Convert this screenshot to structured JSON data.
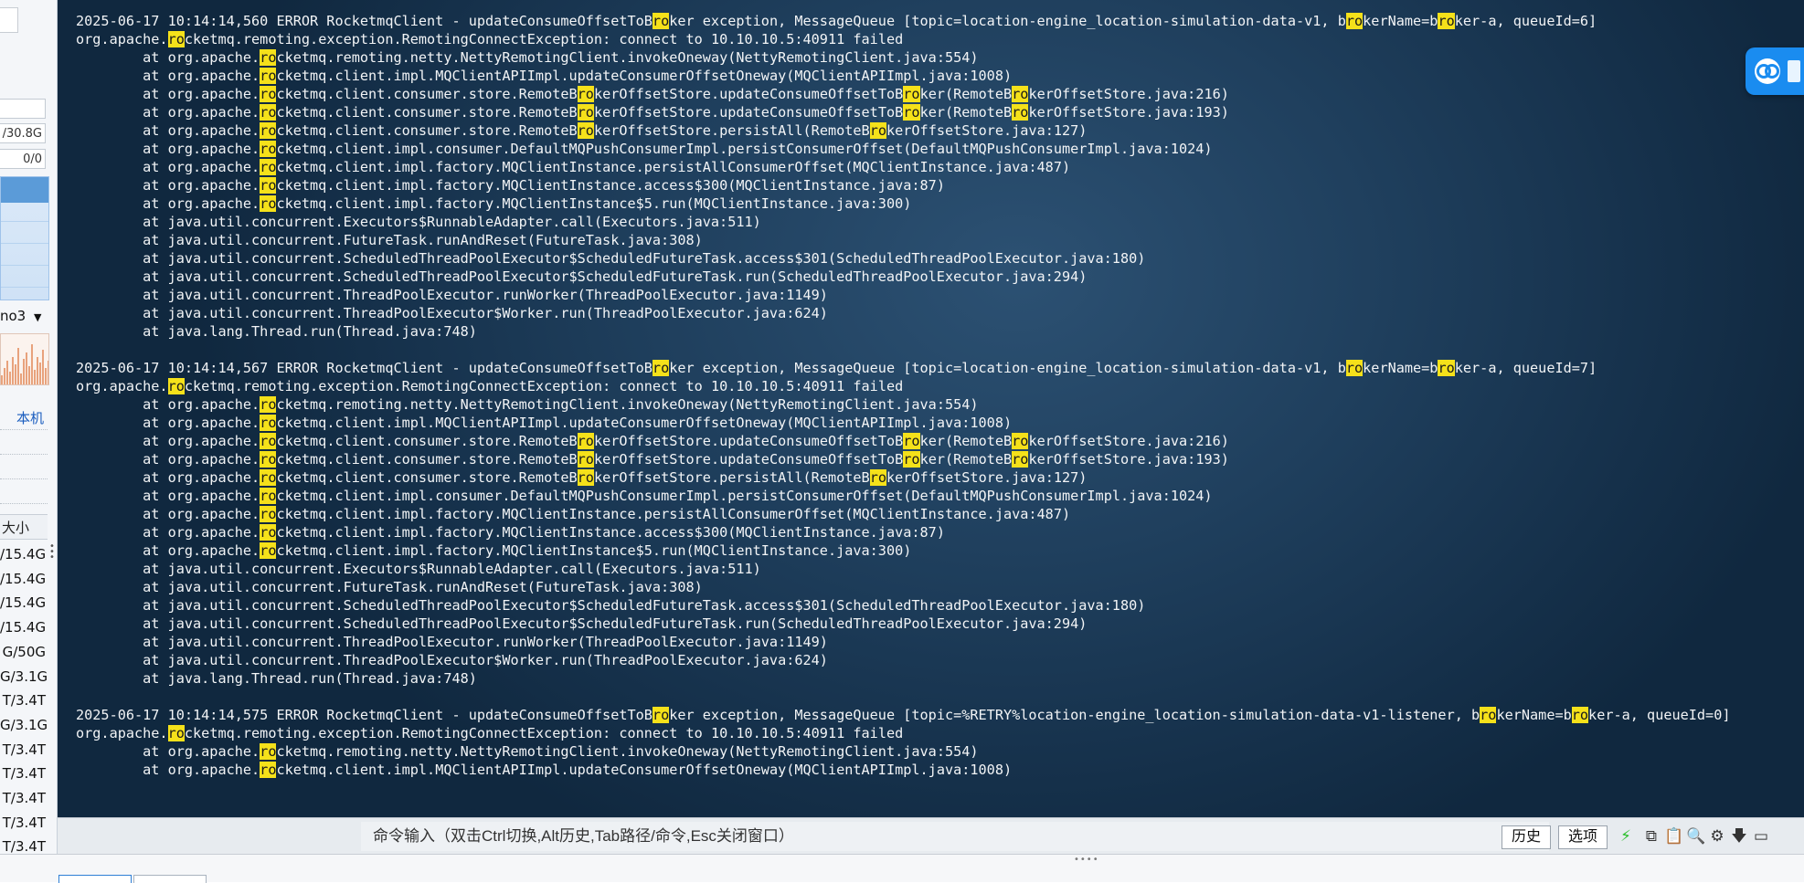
{
  "sidebar": {
    "memory_value": "/30.8G",
    "zero_value": "0/0",
    "dropdown_label": "no3",
    "host_label": "本机",
    "size_header": "大小",
    "sizes": [
      "/15.4G",
      "/15.4G",
      "/15.4G",
      "/15.4G",
      "G/50G",
      "G/3.1G",
      "T/3.4T",
      "G/3.1G",
      "T/3.4T",
      "T/3.4T",
      "T/3.4T",
      "T/3.4T",
      "T/3.4T"
    ]
  },
  "terminal": {
    "log_lines": [
      [
        {
          "t": "2025-06-17 10:14:14,560 ERROR RocketmqClient - updateConsumeOffsetToB"
        },
        {
          "t": "ro",
          "h": true
        },
        {
          "t": "ker exception, MessageQueue [topic=location-engine_location-simulation-data-v1, b"
        },
        {
          "t": "ro",
          "h": true
        },
        {
          "t": "kerName=b"
        },
        {
          "t": "ro",
          "h": true
        },
        {
          "t": "ker-a, queueId=6]"
        }
      ],
      [
        {
          "t": "org.apache."
        },
        {
          "t": "ro",
          "h": true
        },
        {
          "t": "cketmq.remoting.exception.RemotingConnectException: connect to 10.10.10.5:40911 failed"
        }
      ],
      [
        {
          "t": "        at org.apache."
        },
        {
          "t": "ro",
          "h": true
        },
        {
          "t": "cketmq.remoting.netty.NettyRemotingClient.invokeOneway(NettyRemotingClient.java:554)"
        }
      ],
      [
        {
          "t": "        at org.apache."
        },
        {
          "t": "ro",
          "h": true
        },
        {
          "t": "cketmq.client.impl.MQClientAPIImpl.updateConsumerOffsetOneway(MQClientAPIImpl.java:1008)"
        }
      ],
      [
        {
          "t": "        at org.apache."
        },
        {
          "t": "ro",
          "h": true
        },
        {
          "t": "cketmq.client.consumer.store.RemoteB"
        },
        {
          "t": "ro",
          "h": true
        },
        {
          "t": "kerOffsetStore.updateConsumeOffsetToB"
        },
        {
          "t": "ro",
          "h": true
        },
        {
          "t": "ker(RemoteB"
        },
        {
          "t": "ro",
          "h": true
        },
        {
          "t": "kerOffsetStore.java:216)"
        }
      ],
      [
        {
          "t": "        at org.apache."
        },
        {
          "t": "ro",
          "h": true
        },
        {
          "t": "cketmq.client.consumer.store.RemoteB"
        },
        {
          "t": "ro",
          "h": true
        },
        {
          "t": "kerOffsetStore.updateConsumeOffsetToB"
        },
        {
          "t": "ro",
          "h": true
        },
        {
          "t": "ker(RemoteB"
        },
        {
          "t": "ro",
          "h": true
        },
        {
          "t": "kerOffsetStore.java:193)"
        }
      ],
      [
        {
          "t": "        at org.apache."
        },
        {
          "t": "ro",
          "h": true
        },
        {
          "t": "cketmq.client.consumer.store.RemoteB"
        },
        {
          "t": "ro",
          "h": true
        },
        {
          "t": "kerOffsetStore.persistAll(RemoteB"
        },
        {
          "t": "ro",
          "h": true
        },
        {
          "t": "kerOffsetStore.java:127)"
        }
      ],
      [
        {
          "t": "        at org.apache."
        },
        {
          "t": "ro",
          "h": true
        },
        {
          "t": "cketmq.client.impl.consumer.DefaultMQPushConsumerImpl.persistConsumerOffset(DefaultMQPushConsumerImpl.java:1024)"
        }
      ],
      [
        {
          "t": "        at org.apache."
        },
        {
          "t": "ro",
          "h": true
        },
        {
          "t": "cketmq.client.impl.factory.MQClientInstance.persistAllConsumerOffset(MQClientInstance.java:487)"
        }
      ],
      [
        {
          "t": "        at org.apache."
        },
        {
          "t": "ro",
          "h": true
        },
        {
          "t": "cketmq.client.impl.factory.MQClientInstance.access$300(MQClientInstance.java:87)"
        }
      ],
      [
        {
          "t": "        at org.apache."
        },
        {
          "t": "ro",
          "h": true
        },
        {
          "t": "cketmq.client.impl.factory.MQClientInstance$5.run(MQClientInstance.java:300)"
        }
      ],
      [
        {
          "t": "        at java.util.concurrent.Executors$RunnableAdapter.call(Executors.java:511)"
        }
      ],
      [
        {
          "t": "        at java.util.concurrent.FutureTask.runAndReset(FutureTask.java:308)"
        }
      ],
      [
        {
          "t": "        at java.util.concurrent.ScheduledThreadPoolExecutor$ScheduledFutureTask.access$301(ScheduledThreadPoolExecutor.java:180)"
        }
      ],
      [
        {
          "t": "        at java.util.concurrent.ScheduledThreadPoolExecutor$ScheduledFutureTask.run(ScheduledThreadPoolExecutor.java:294)"
        }
      ],
      [
        {
          "t": "        at java.util.concurrent.ThreadPoolExecutor.runWorker(ThreadPoolExecutor.java:1149)"
        }
      ],
      [
        {
          "t": "        at java.util.concurrent.ThreadPoolExecutor$Worker.run(ThreadPoolExecutor.java:624)"
        }
      ],
      [
        {
          "t": "        at java.lang.Thread.run(Thread.java:748)"
        }
      ],
      [
        {
          "t": ""
        }
      ],
      [
        {
          "t": "2025-06-17 10:14:14,567 ERROR RocketmqClient - updateConsumeOffsetToB"
        },
        {
          "t": "ro",
          "h": true
        },
        {
          "t": "ker exception, MessageQueue [topic=location-engine_location-simulation-data-v1, b"
        },
        {
          "t": "ro",
          "h": true
        },
        {
          "t": "kerName=b"
        },
        {
          "t": "ro",
          "h": true
        },
        {
          "t": "ker-a, queueId=7]"
        }
      ],
      [
        {
          "t": "org.apache."
        },
        {
          "t": "ro",
          "h": true
        },
        {
          "t": "cketmq.remoting.exception.RemotingConnectException: connect to 10.10.10.5:40911 failed"
        }
      ],
      [
        {
          "t": "        at org.apache."
        },
        {
          "t": "ro",
          "h": true
        },
        {
          "t": "cketmq.remoting.netty.NettyRemotingClient.invokeOneway(NettyRemotingClient.java:554)"
        }
      ],
      [
        {
          "t": "        at org.apache."
        },
        {
          "t": "ro",
          "h": true
        },
        {
          "t": "cketmq.client.impl.MQClientAPIImpl.updateConsumerOffsetOneway(MQClientAPIImpl.java:1008)"
        }
      ],
      [
        {
          "t": "        at org.apache."
        },
        {
          "t": "ro",
          "h": true
        },
        {
          "t": "cketmq.client.consumer.store.RemoteB"
        },
        {
          "t": "ro",
          "h": true
        },
        {
          "t": "kerOffsetStore.updateConsumeOffsetToB"
        },
        {
          "t": "ro",
          "h": true
        },
        {
          "t": "ker(RemoteB"
        },
        {
          "t": "ro",
          "h": true
        },
        {
          "t": "kerOffsetStore.java:216)"
        }
      ],
      [
        {
          "t": "        at org.apache."
        },
        {
          "t": "ro",
          "h": true
        },
        {
          "t": "cketmq.client.consumer.store.RemoteB"
        },
        {
          "t": "ro",
          "h": true
        },
        {
          "t": "kerOffsetStore.updateConsumeOffsetToB"
        },
        {
          "t": "ro",
          "h": true
        },
        {
          "t": "ker(RemoteB"
        },
        {
          "t": "ro",
          "h": true
        },
        {
          "t": "kerOffsetStore.java:193)"
        }
      ],
      [
        {
          "t": "        at org.apache."
        },
        {
          "t": "ro",
          "h": true
        },
        {
          "t": "cketmq.client.consumer.store.RemoteB"
        },
        {
          "t": "ro",
          "h": true
        },
        {
          "t": "kerOffsetStore.persistAll(RemoteB"
        },
        {
          "t": "ro",
          "h": true
        },
        {
          "t": "kerOffsetStore.java:127)"
        }
      ],
      [
        {
          "t": "        at org.apache."
        },
        {
          "t": "ro",
          "h": true
        },
        {
          "t": "cketmq.client.impl.consumer.DefaultMQPushConsumerImpl.persistConsumerOffset(DefaultMQPushConsumerImpl.java:1024)"
        }
      ],
      [
        {
          "t": "        at org.apache."
        },
        {
          "t": "ro",
          "h": true
        },
        {
          "t": "cketmq.client.impl.factory.MQClientInstance.persistAllConsumerOffset(MQClientInstance.java:487)"
        }
      ],
      [
        {
          "t": "        at org.apache."
        },
        {
          "t": "ro",
          "h": true
        },
        {
          "t": "cketmq.client.impl.factory.MQClientInstance.access$300(MQClientInstance.java:87)"
        }
      ],
      [
        {
          "t": "        at org.apache."
        },
        {
          "t": "ro",
          "h": true
        },
        {
          "t": "cketmq.client.impl.factory.MQClientInstance$5.run(MQClientInstance.java:300)"
        }
      ],
      [
        {
          "t": "        at java.util.concurrent.Executors$RunnableAdapter.call(Executors.java:511)"
        }
      ],
      [
        {
          "t": "        at java.util.concurrent.FutureTask.runAndReset(FutureTask.java:308)"
        }
      ],
      [
        {
          "t": "        at java.util.concurrent.ScheduledThreadPoolExecutor$ScheduledFutureTask.access$301(ScheduledThreadPoolExecutor.java:180)"
        }
      ],
      [
        {
          "t": "        at java.util.concurrent.ScheduledThreadPoolExecutor$ScheduledFutureTask.run(ScheduledThreadPoolExecutor.java:294)"
        }
      ],
      [
        {
          "t": "        at java.util.concurrent.ThreadPoolExecutor.runWorker(ThreadPoolExecutor.java:1149)"
        }
      ],
      [
        {
          "t": "        at java.util.concurrent.ThreadPoolExecutor$Worker.run(ThreadPoolExecutor.java:624)"
        }
      ],
      [
        {
          "t": "        at java.lang.Thread.run(Thread.java:748)"
        }
      ],
      [
        {
          "t": ""
        }
      ],
      [
        {
          "t": "2025-06-17 10:14:14,575 ERROR RocketmqClient - updateConsumeOffsetToB"
        },
        {
          "t": "ro",
          "h": true
        },
        {
          "t": "ker exception, MessageQueue [topic=%RETRY%location-engine_location-simulation-data-v1-listener, b"
        },
        {
          "t": "ro",
          "h": true
        },
        {
          "t": "kerName=b"
        },
        {
          "t": "ro",
          "h": true
        },
        {
          "t": "ker-a, queueId=0]"
        }
      ],
      [
        {
          "t": "org.apache."
        },
        {
          "t": "ro",
          "h": true
        },
        {
          "t": "cketmq.remoting.exception.RemotingConnectException: connect to 10.10.10.5:40911 failed"
        }
      ],
      [
        {
          "t": "        at org.apache."
        },
        {
          "t": "ro",
          "h": true
        },
        {
          "t": "cketmq.remoting.netty.NettyRemotingClient.invokeOneway(NettyRemotingClient.java:554)"
        }
      ],
      [
        {
          "t": "        at org.apache."
        },
        {
          "t": "ro",
          "h": true
        },
        {
          "t": "cketmq.client.impl.MQClientAPIImpl.updateConsumerOffsetOneway(MQClientAPIImpl.java:1008)"
        }
      ]
    ]
  },
  "float_button": {
    "icon": "cloud-link-icon"
  },
  "command_bar": {
    "placeholder": "命令输入（双击Ctrl切换,Alt历史,Tab路径/命令,Esc关闭窗口）",
    "history_label": "历史",
    "options_label": "选项",
    "icons": [
      "lightning-icon",
      "copy-icon",
      "paste-icon",
      "search-icon",
      "gear-icon",
      "arrow-down-icon",
      "maximize-icon"
    ]
  },
  "colors": {
    "terminal_bg": "#1f3f5d",
    "highlight": "#f5e11a",
    "accent_blue": "#1a8cf0",
    "lightning": "#2cbf2c"
  }
}
